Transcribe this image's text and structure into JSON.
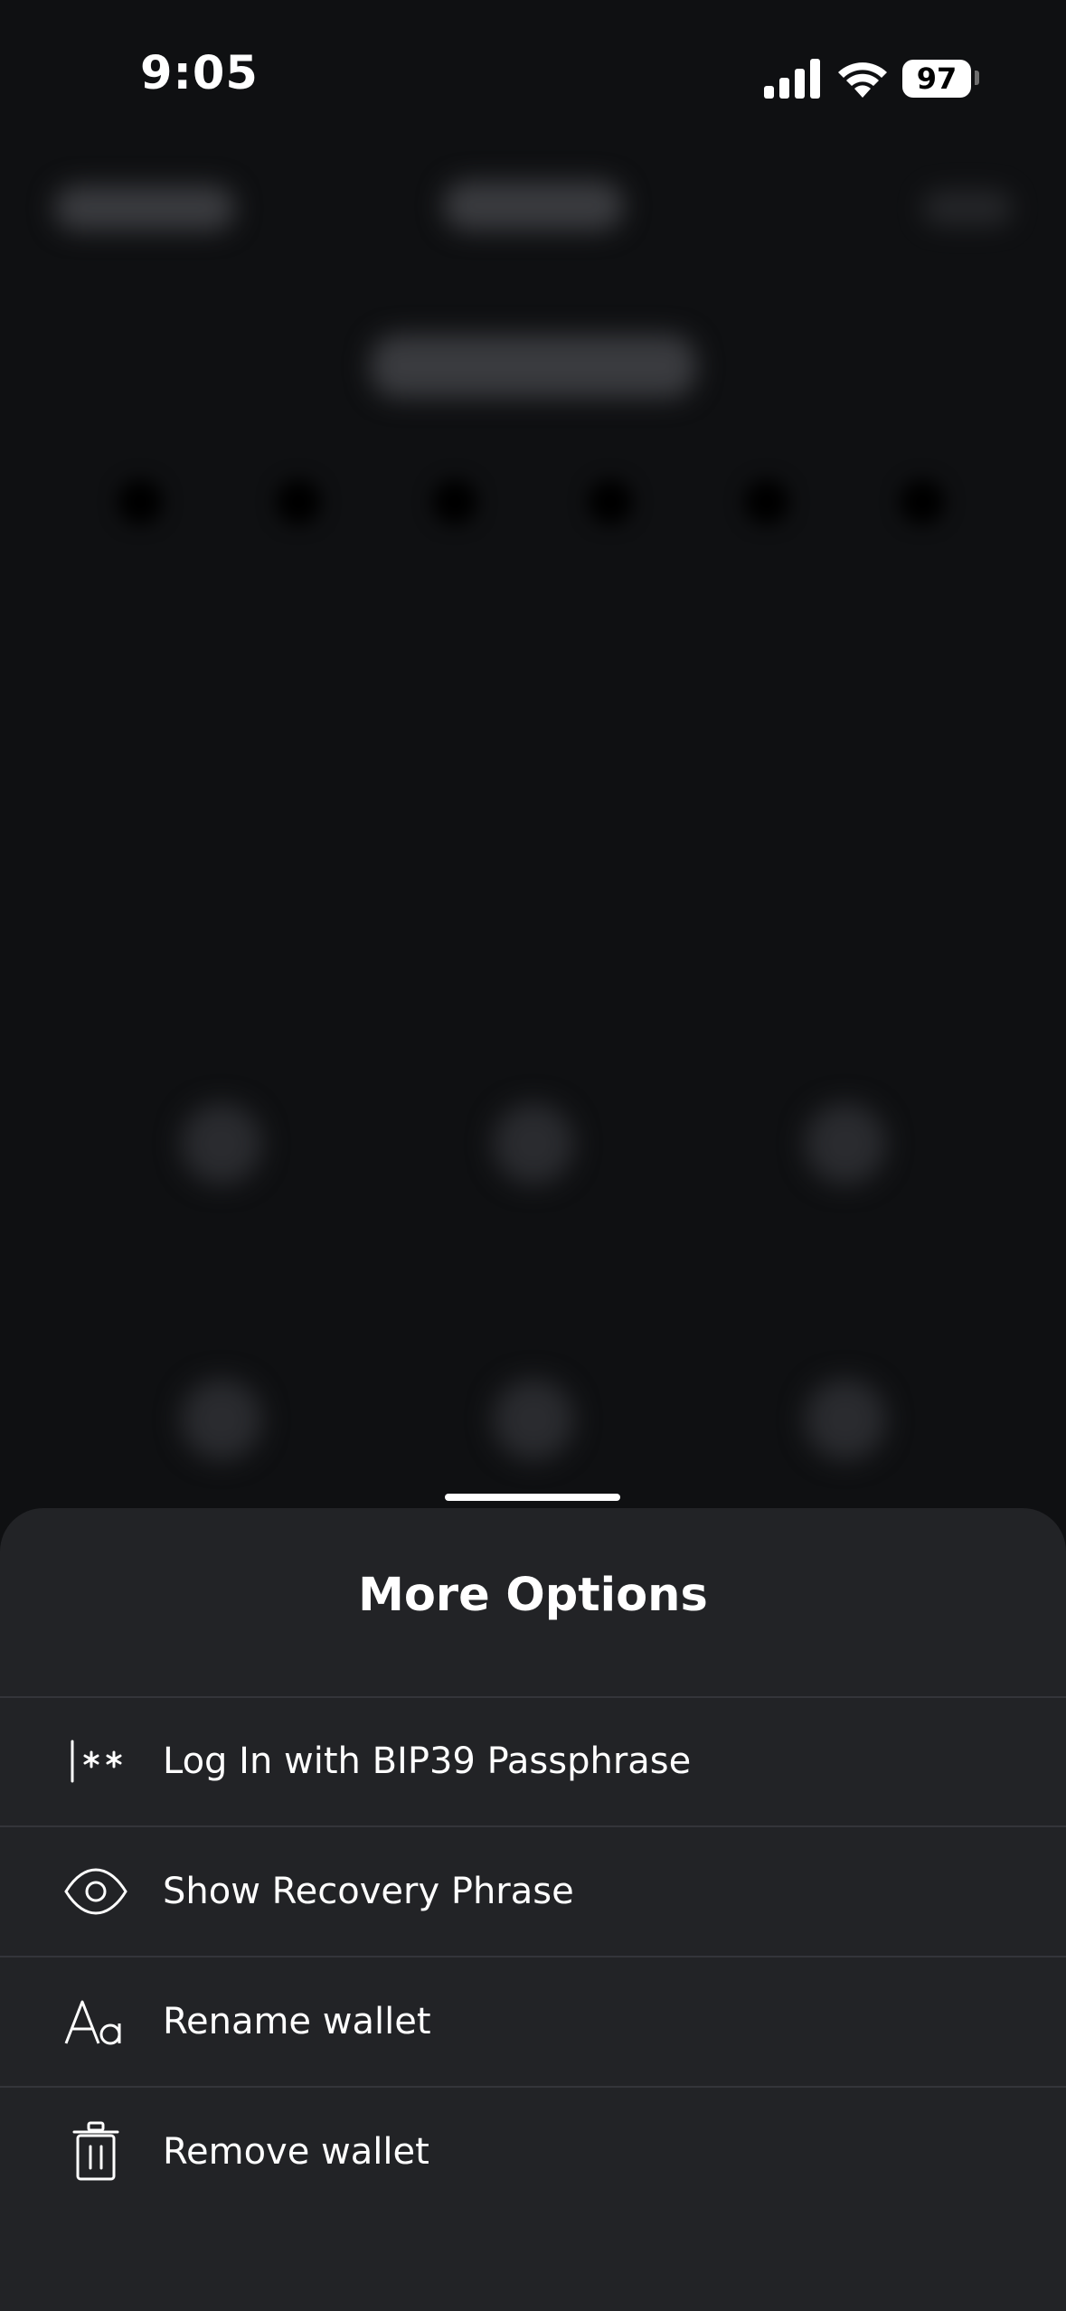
{
  "status_bar": {
    "time": "9:05",
    "battery_level": "97"
  },
  "sheet": {
    "title": "More Options",
    "options": [
      {
        "label": "Log In with BIP39 Passphrase",
        "icon": "passphrase-icon"
      },
      {
        "label": "Show Recovery Phrase",
        "icon": "eye-icon"
      },
      {
        "label": "Rename wallet",
        "icon": "text-format-icon"
      },
      {
        "label": "Remove wallet",
        "icon": "trash-icon"
      }
    ]
  },
  "colors": {
    "background": "#0f1012",
    "sheet": "#222326",
    "divider": "#34353a",
    "text": "#ffffff"
  }
}
